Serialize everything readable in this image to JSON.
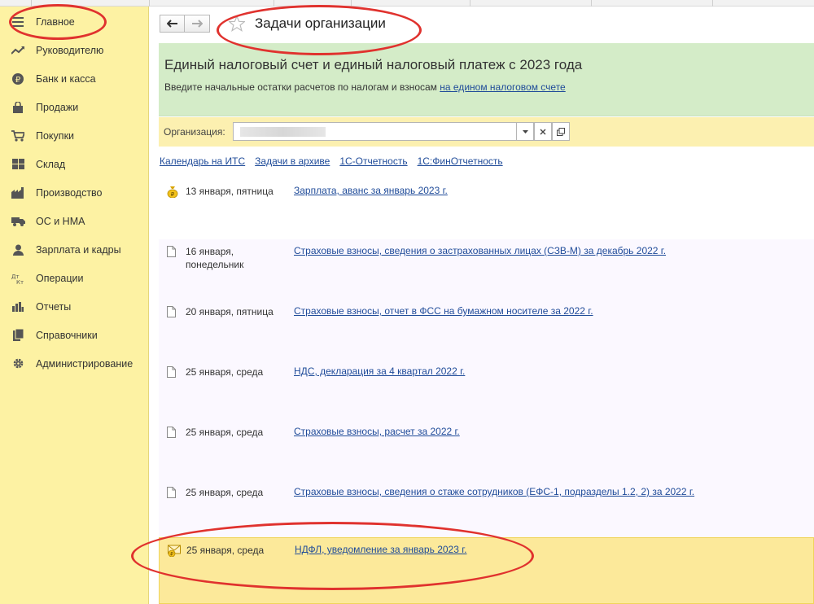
{
  "sidebar": {
    "items": [
      {
        "label": "Главное",
        "icon": "hamburger-menu-icon"
      },
      {
        "label": "Руководителю",
        "icon": "trend-chart-icon"
      },
      {
        "label": "Банк и касса",
        "icon": "ruble-coin-icon"
      },
      {
        "label": "Продажи",
        "icon": "shopping-bag-icon"
      },
      {
        "label": "Покупки",
        "icon": "shopping-cart-icon"
      },
      {
        "label": "Склад",
        "icon": "warehouse-grid-icon"
      },
      {
        "label": "Производство",
        "icon": "factory-icon"
      },
      {
        "label": "ОС и НМА",
        "icon": "truck-icon"
      },
      {
        "label": "Зарплата и кадры",
        "icon": "person-icon"
      },
      {
        "label": "Операции",
        "icon": "debit-credit-icon"
      },
      {
        "label": "Отчеты",
        "icon": "bar-chart-icon"
      },
      {
        "label": "Справочники",
        "icon": "books-icon"
      },
      {
        "label": "Администрирование",
        "icon": "gear-icon"
      }
    ]
  },
  "header": {
    "title": "Задачи организации"
  },
  "banner": {
    "title": "Единый налоговый счет и единый налоговый платеж с 2023 года",
    "text": "Введите начальные остатки расчетов по налогам и взносам",
    "link": "на едином налоговом счете"
  },
  "org": {
    "label": "Организация:",
    "value": ""
  },
  "links": [
    "Календарь на ИТС",
    "Задачи в архиве",
    "1С-Отчетность",
    "1С:ФинОтчетность"
  ],
  "tasks": [
    {
      "date": "13 января, пятница",
      "title": "Зарплата, аванс за январь 2023 г.",
      "icon": "money-bag-icon"
    },
    {
      "date": "16 января, понедельник",
      "title": "Страховые взносы, сведения о застрахованных лицах (СЗВ-М) за декабрь 2022 г.",
      "icon": "document-icon"
    },
    {
      "date": "20 января, пятница",
      "title": "Страховые взносы, отчет в ФСС на бумажном носителе за 2022 г.",
      "icon": "document-icon"
    },
    {
      "date": "25 января, среда",
      "title": "НДС, декларация за 4 квартал 2022 г.",
      "icon": "document-icon"
    },
    {
      "date": "25 января, среда",
      "title": "Страховые взносы, расчет за 2022 г.",
      "icon": "document-icon"
    },
    {
      "date": "25 января, среда",
      "title": "Страховые взносы, сведения о стаже сотрудников (ЕФС-1, подразделы 1.2, 2) за 2022 г.",
      "icon": "document-icon"
    },
    {
      "date": "25 января, среда",
      "title": "НДФЛ, уведомление за январь 2023 г.",
      "icon": "envelope-ruble-icon"
    }
  ],
  "colors": {
    "sidebar_bg": "#fdf2a3",
    "banner_bg": "#d4ecc8",
    "highlight_bg": "#fce99a",
    "link": "#1f4b99",
    "annotation": "#e0322e"
  }
}
